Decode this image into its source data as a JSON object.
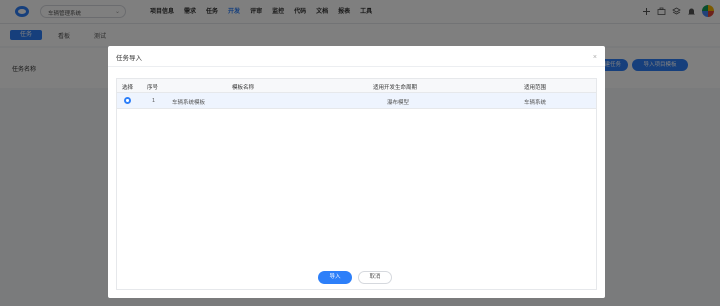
{
  "header": {
    "project": "车辆管理系统",
    "nav": [
      "项目信息",
      "需求",
      "任务",
      "开发",
      "评审",
      "监控",
      "代码",
      "文档",
      "报表",
      "工具"
    ],
    "active_nav": "开发"
  },
  "subtabs": [
    "任务",
    "看板",
    "测试"
  ],
  "page": {
    "column_label": "任务名称",
    "bg_buttons": [
      "新建任务",
      "导入项目模板"
    ]
  },
  "modal": {
    "title": "任务导入",
    "close": "×",
    "table": {
      "headers": [
        "选择",
        "序号",
        "模板名称",
        "适用开发生命周期",
        "适用范围"
      ],
      "rows": [
        {
          "index": "1",
          "template": "车辆系统模板",
          "lifecycle": "瀑布模型",
          "scope": "车辆系统",
          "selected": true
        }
      ]
    },
    "buttons": {
      "import": "导入",
      "cancel": "取消"
    }
  },
  "colors": {
    "accent": "#2d7ff9"
  }
}
